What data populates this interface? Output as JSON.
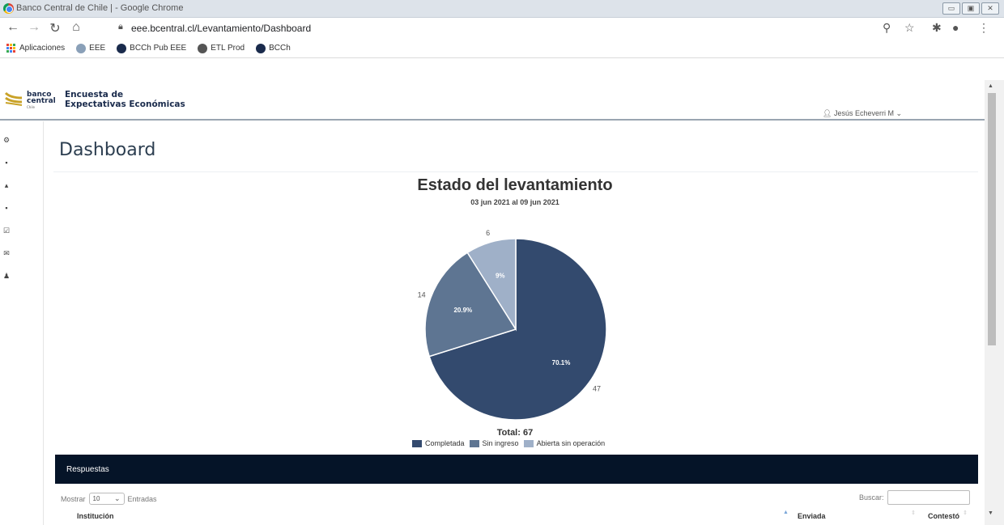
{
  "window": {
    "title": "Banco Central de Chile | - Google Chrome"
  },
  "browser": {
    "url": "eee.bcentral.cl/Levantamiento/Dashboard",
    "bookmarks": [
      "Aplicaciones",
      "EEE",
      "BCCh Pub EEE",
      "ETL Prod",
      "BCCh"
    ]
  },
  "app": {
    "logo": {
      "line1": "banco",
      "line2": "central",
      "line3": "Chile"
    },
    "brand_line1": "Encuesta de",
    "brand_line2": "Expectativas Económicas",
    "user": "Jesús Echeverri M"
  },
  "page": {
    "title": "Dashboard"
  },
  "chart_data": {
    "type": "pie",
    "title": "Estado del levantamiento",
    "subtitle": "03 jun 2021 al 09 jun 2021",
    "total_label": "Total: 67",
    "legend_position": "bottom",
    "slices": [
      {
        "name": "Completada",
        "value": 47,
        "percent_label": "70.1%",
        "color": "#334a6e"
      },
      {
        "name": "Sin ingreso",
        "value": 14,
        "percent_label": "20.9%",
        "color": "#5e7592"
      },
      {
        "name": "Abierta sin operación",
        "value": 6,
        "percent_label": "9%",
        "color": "#9fb0c8"
      }
    ]
  },
  "responses": {
    "title": "Respuestas",
    "show_label": "Mostrar",
    "entries_value": "10",
    "entries_label": "Entradas",
    "search_label": "Buscar:",
    "columns": [
      "Institución",
      "Enviada",
      "Contestó"
    ]
  }
}
